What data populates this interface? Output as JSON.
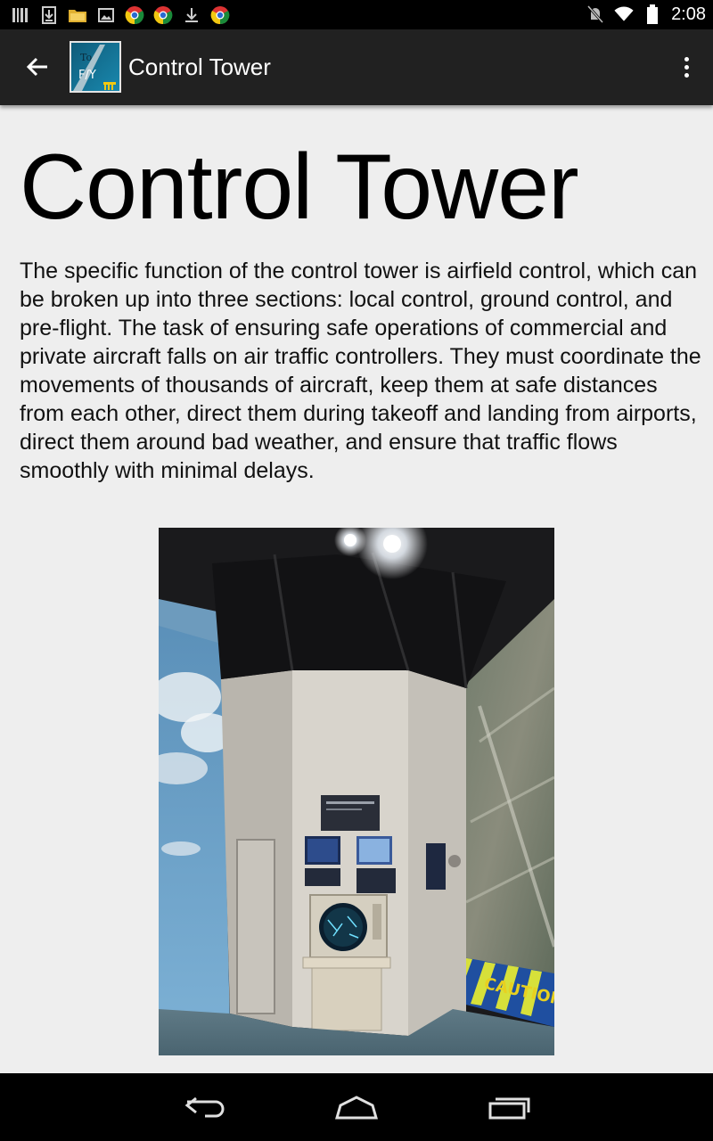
{
  "status_bar": {
    "time": "2:08",
    "left_icons": [
      "barcode-icon",
      "download-box-icon",
      "folder-icon",
      "image-icon",
      "chrome-icon",
      "chrome-icon",
      "download-icon",
      "chrome-icon"
    ],
    "right_icons": [
      "mute-icon",
      "wifi-icon",
      "battery-icon"
    ]
  },
  "action_bar": {
    "title": "Control Tower",
    "logo_text_top": "To",
    "logo_text_bottom": "F/Y",
    "background": "#212121"
  },
  "content": {
    "heading": "Control Tower",
    "body": "The specific function of the control tower is airfield control, which can be broken up into three sections: local control, ground control, and pre-flight. The task of ensuring safe operations of commercial and private aircraft falls on air traffic controllers. They must coordinate the movements of thousands of aircraft, keep them at safe distances from each other, direct them during takeoff and landing from airports, direct them around bad weather, and ensure that traffic flows smoothly with minimal delays.",
    "background": "#eeeeee",
    "photo": {
      "caution_text": "CAUTION"
    }
  },
  "nav_bar": {
    "buttons": [
      "back-icon",
      "home-icon",
      "recents-icon"
    ]
  }
}
